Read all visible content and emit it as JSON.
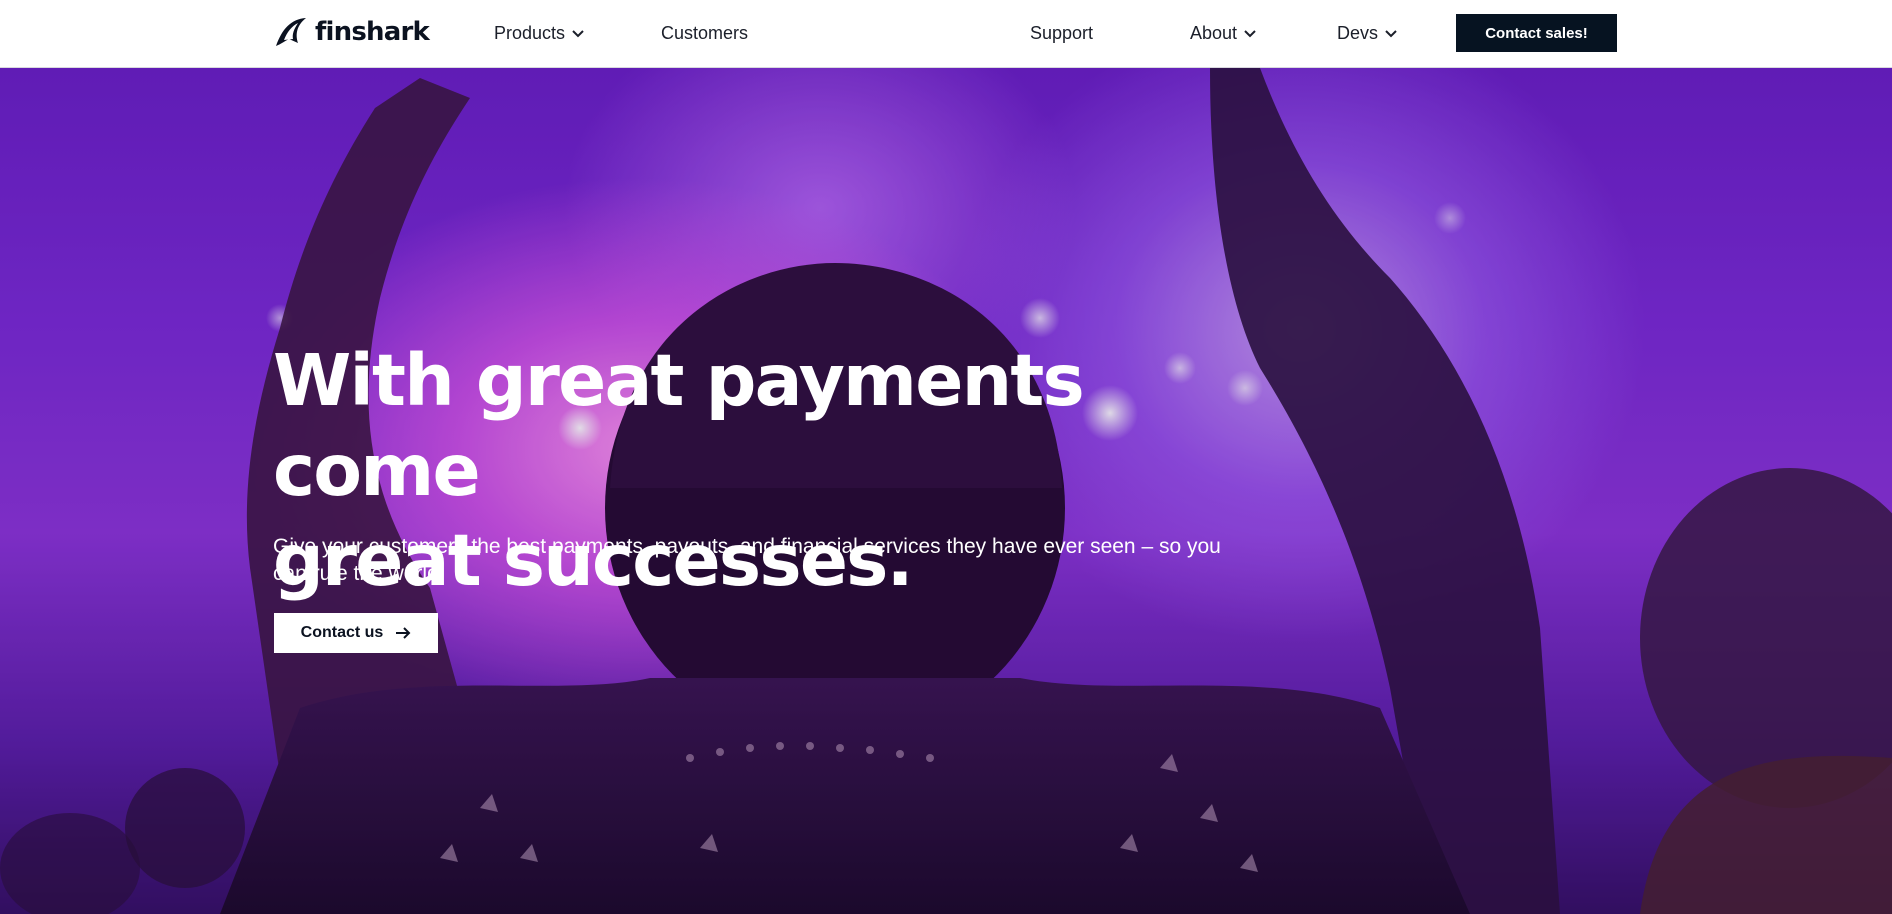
{
  "brand": {
    "name": "finshark",
    "logo_icon": "shark-fin-icon"
  },
  "nav": {
    "items": [
      {
        "label": "Products",
        "has_dropdown": true
      },
      {
        "label": "Customers",
        "has_dropdown": false
      },
      {
        "label": "Support",
        "has_dropdown": false
      },
      {
        "label": "About",
        "has_dropdown": true
      },
      {
        "label": "Devs",
        "has_dropdown": true
      }
    ],
    "cta_label": "Contact sales!"
  },
  "hero": {
    "title_line1": "With great payments come",
    "title_line2": "great successes.",
    "subtitle": "Give your customers the best payments, payouts, and financial services they have ever seen – so you can rule the world.",
    "cta_label": "Contact us",
    "cta_icon": "arrow-right-icon"
  },
  "colors": {
    "nav_background": "#ffffff",
    "cta_dark": "#061321",
    "hero_purple": "#7a2ad6",
    "hero_pink": "#e25aeb",
    "text_light": "#ffffff"
  }
}
